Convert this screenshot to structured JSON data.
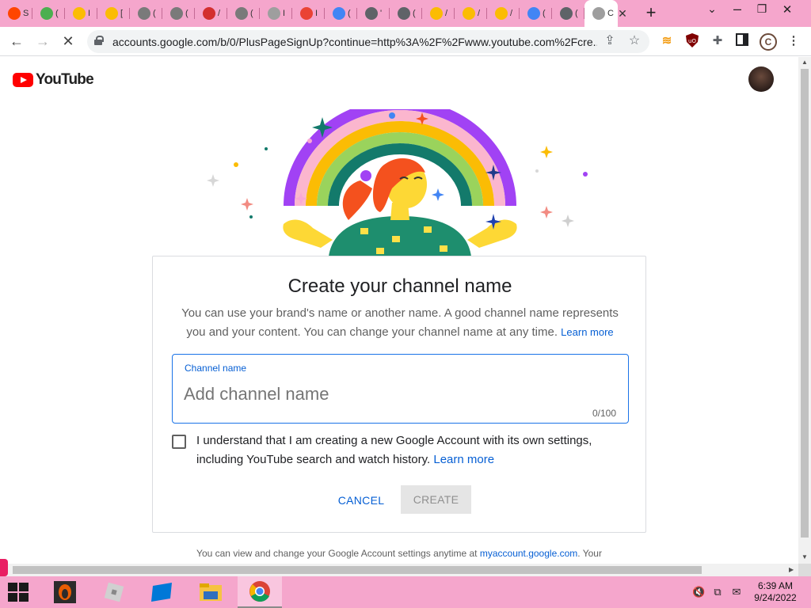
{
  "browser": {
    "tabs": [
      {
        "icon": "reddit-icon",
        "letter": "S",
        "color": "#ff4500"
      },
      {
        "icon": "drive-multicolor-icon",
        "letter": "(",
        "color": "#4caf50"
      },
      {
        "icon": "google-drive-icon",
        "letter": "I",
        "color": "#fbbc04"
      },
      {
        "icon": "google-drive-icon",
        "letter": "[",
        "color": "#fbbc04"
      },
      {
        "icon": "globe-icon",
        "letter": "(",
        "color": "#7a7a7a"
      },
      {
        "icon": "globe-icon",
        "letter": "(",
        "color": "#7a7a7a"
      },
      {
        "icon": "red-bird-icon",
        "letter": "/",
        "color": "#d32f2f"
      },
      {
        "icon": "globe-icon",
        "letter": "(",
        "color": "#7a7a7a"
      },
      {
        "icon": "roblox-icon",
        "letter": "I",
        "color": "#9e9e9e"
      },
      {
        "icon": "gmail-icon",
        "letter": "I",
        "color": "#ea4335"
      },
      {
        "icon": "google-icon",
        "letter": "(",
        "color": "#4285f4"
      },
      {
        "icon": "gear-icon",
        "letter": "'",
        "color": "#5f6368"
      },
      {
        "icon": "chrome-icon",
        "letter": "(",
        "color": "#5f6368"
      },
      {
        "icon": "google-drive-icon",
        "letter": "/",
        "color": "#fbbc04"
      },
      {
        "icon": "google-drive-icon",
        "letter": "/",
        "color": "#fbbc04"
      },
      {
        "icon": "google-drive-icon",
        "letter": "/",
        "color": "#fbbc04"
      },
      {
        "icon": "contacts-icon",
        "letter": "(",
        "color": "#4285f4"
      },
      {
        "icon": "chrome-icon",
        "letter": "(",
        "color": "#5f6368"
      }
    ],
    "active_tab_letter": "C",
    "url": "accounts.google.com/b/0/PlusPageSignUp?continue=http%3A%2F%2Fwww.youtube.com%2Fcre...",
    "profile_letter": "C"
  },
  "youtube": {
    "logo_text": "YouTube"
  },
  "card": {
    "title": "Create your channel name",
    "description": "You can use your brand's name or another name. A good channel name represents you and your content. You can change your channel name at any time.",
    "learn_more_inline": "Learn more",
    "field_label": "Channel name",
    "field_placeholder": "Add channel name",
    "field_value": "",
    "counter": "0/100",
    "checkbox_text": "I understand that I am creating a new Google Account with its own settings, including YouTube search and watch history.",
    "checkbox_learn_more": "Learn more",
    "checkbox_checked": false,
    "cancel_label": "CANCEL",
    "create_label": "CREATE"
  },
  "footer": {
    "text": "You can view and change your Google Account settings anytime at",
    "link": "myaccount.google.com",
    "suffix": ". Your"
  },
  "taskbar": {
    "time": "6:39 AM",
    "date": "9/24/2022"
  },
  "colors": {
    "tabstrip": "#f5a6cc",
    "link_blue": "#065fd4",
    "youtube_red": "#ff0000"
  }
}
